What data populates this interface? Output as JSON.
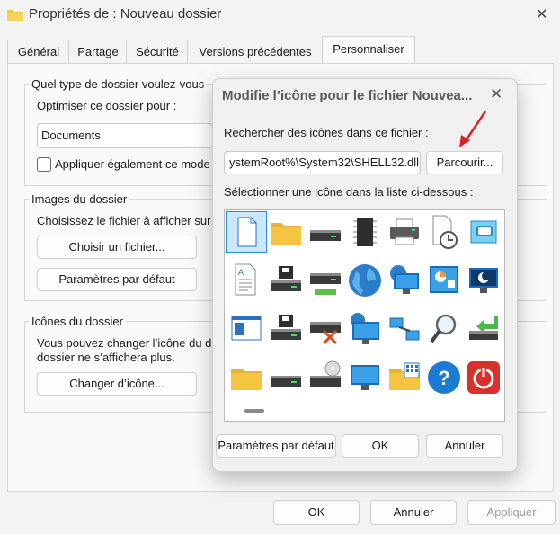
{
  "window": {
    "title": "Propriétés de : Nouveau dossier",
    "close_glyph": "✕"
  },
  "tabs": [
    {
      "label": "Général"
    },
    {
      "label": "Partage"
    },
    {
      "label": "Sécurité"
    },
    {
      "label": "Versions précédentes"
    },
    {
      "label": "Personnaliser",
      "active": true
    }
  ],
  "customize": {
    "folder_type_title": "Quel type de dossier voulez-vous",
    "optimize_label": "Optimiser ce dossier pour :",
    "optimize_value": "Documents",
    "apply_sub_label": "Appliquer également ce mode",
    "images_title": "Images du dossier",
    "images_desc": "Choisissez le fichier à afficher sur",
    "choose_file_btn": "Choisir un fichier...",
    "default_btn": "Paramètres par défaut",
    "icons_title": "Icônes du dossier",
    "icons_desc_1": "Vous pouvez changer l’icône du d",
    "icons_desc_2": "dossier ne s’affichera plus.",
    "change_icon_btn": "Changer d’icône..."
  },
  "footer": {
    "ok": "OK",
    "cancel": "Annuler",
    "apply": "Appliquer"
  },
  "dialog": {
    "title": "Modifie l’icône pour le fichier Nouvea...",
    "close_glyph": "✕",
    "search_label": "Rechercher des icônes dans ce fichier :",
    "file_path": "ystemRoot%\\System32\\SHELL32.dll",
    "browse_btn": "Parcourir...",
    "list_label": "Sélectionner une icône dans la liste ci-dessous :",
    "default_btn": "Paramètres par défaut",
    "ok_btn": "OK",
    "cancel_btn": "Annuler",
    "icons": [
      [
        "blank-document-icon",
        "folder-icon",
        "drive-icon",
        "chip-icon",
        "printer-icon",
        "clock-document-icon",
        "window-app-icon"
      ],
      [
        "text-document-icon",
        "floppy-drive-icon",
        "network-drive-icon",
        "globe-icon",
        "network-monitor-icon",
        "control-panel-icon",
        "sleep-monitor-icon"
      ],
      [
        "app-window-icon",
        "floppy-drive2-icon",
        "disconnected-drive-icon",
        "internet-monitor-icon",
        "network-connection-icon",
        "search-icon",
        "install-icon"
      ],
      [
        "folder-closed-icon",
        "drive2-icon",
        "cd-drive-icon",
        "monitor-icon",
        "folder-grid-icon",
        "help-icon",
        "power-icon"
      ]
    ]
  },
  "colors": {
    "accent": "#2a8bd8",
    "arrow": "#e02020",
    "folder": "#f5c542"
  }
}
